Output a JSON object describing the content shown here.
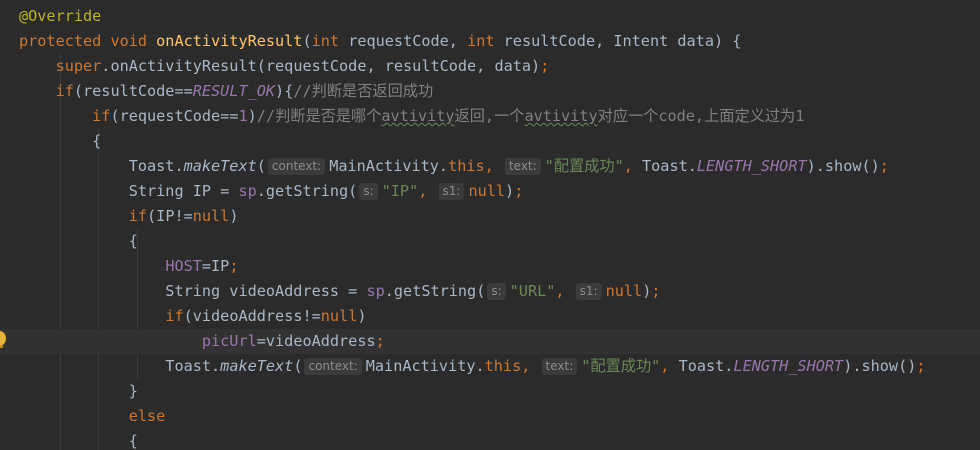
{
  "editor": {
    "language": "java",
    "current_line_index": 13,
    "lines": [
      {
        "tokens": [
          {
            "t": "@Override",
            "c": "ann"
          }
        ]
      },
      {
        "tokens": [
          {
            "t": "protected ",
            "c": "kw"
          },
          {
            "t": "void ",
            "c": "kw"
          },
          {
            "t": "onActivityResult",
            "c": "fn"
          },
          {
            "t": "(",
            "c": "plain"
          },
          {
            "t": "int ",
            "c": "kw"
          },
          {
            "t": "requestCode, ",
            "c": "plain"
          },
          {
            "t": "int ",
            "c": "kw"
          },
          {
            "t": "resultCode, Intent data) {",
            "c": "plain"
          }
        ]
      },
      {
        "tokens": [
          {
            "t": "    ",
            "c": "plain"
          },
          {
            "t": "super",
            "c": "kw"
          },
          {
            "t": ".onActivityResult(requestCode, resultCode, data)",
            "c": "plain"
          },
          {
            "t": ";",
            "c": "kw"
          }
        ]
      },
      {
        "tokens": [
          {
            "t": "    ",
            "c": "plain"
          },
          {
            "t": "if",
            "c": "kw"
          },
          {
            "t": "(resultCode==",
            "c": "plain"
          },
          {
            "t": "RESULT_OK",
            "c": "sfld"
          },
          {
            "t": "){",
            "c": "plain"
          },
          {
            "t": "//判断是否返回成功",
            "c": "com"
          }
        ]
      },
      {
        "tokens": [
          {
            "t": "        ",
            "c": "plain"
          },
          {
            "t": "if",
            "c": "kw"
          },
          {
            "t": "(requestCode==",
            "c": "plain"
          },
          {
            "t": "1",
            "c": "fld"
          },
          {
            "t": ")",
            "c": "plain"
          },
          {
            "t": "//判断是否是哪个",
            "c": "com"
          },
          {
            "t": "avtivity",
            "c": "com typo"
          },
          {
            "t": "返回,一个",
            "c": "com"
          },
          {
            "t": "avtivity",
            "c": "com typo"
          },
          {
            "t": "对应一个code,上面定义过为1",
            "c": "com"
          }
        ]
      },
      {
        "tokens": [
          {
            "t": "        {",
            "c": "plain"
          }
        ]
      },
      {
        "tokens": [
          {
            "t": "            Toast.",
            "c": "plain"
          },
          {
            "t": "makeText",
            "c": "ital"
          },
          {
            "t": "(",
            "c": "plain"
          },
          {
            "t": "context:",
            "c": "hint"
          },
          {
            "t": "MainActivity.",
            "c": "plain"
          },
          {
            "t": "this",
            "c": "kw"
          },
          {
            "t": ", ",
            "c": "kw"
          },
          {
            "t": "text:",
            "c": "hint"
          },
          {
            "t": "\"配置成功\"",
            "c": "str"
          },
          {
            "t": ", ",
            "c": "kw"
          },
          {
            "t": "Toast.",
            "c": "plain"
          },
          {
            "t": "LENGTH_SHORT",
            "c": "sfld"
          },
          {
            "t": ").show()",
            "c": "plain"
          },
          {
            "t": ";",
            "c": "kw"
          }
        ]
      },
      {
        "tokens": [
          {
            "t": "            String IP = ",
            "c": "plain"
          },
          {
            "t": "sp",
            "c": "fld"
          },
          {
            "t": ".getString(",
            "c": "plain"
          },
          {
            "t": "s:",
            "c": "hint"
          },
          {
            "t": "\"IP\"",
            "c": "str"
          },
          {
            "t": ", ",
            "c": "kw"
          },
          {
            "t": "s1:",
            "c": "hint"
          },
          {
            "t": "null",
            "c": "kw"
          },
          {
            "t": ")",
            "c": "plain"
          },
          {
            "t": ";",
            "c": "kw"
          }
        ]
      },
      {
        "tokens": [
          {
            "t": "            ",
            "c": "plain"
          },
          {
            "t": "if",
            "c": "kw"
          },
          {
            "t": "(IP!=",
            "c": "plain"
          },
          {
            "t": "null",
            "c": "kw"
          },
          {
            "t": ")",
            "c": "plain"
          }
        ]
      },
      {
        "tokens": [
          {
            "t": "            {",
            "c": "plain"
          }
        ]
      },
      {
        "tokens": [
          {
            "t": "                ",
            "c": "plain"
          },
          {
            "t": "HOST",
            "c": "fld"
          },
          {
            "t": "=IP",
            "c": "plain"
          },
          {
            "t": ";",
            "c": "kw"
          }
        ]
      },
      {
        "tokens": [
          {
            "t": "                String videoAddress = ",
            "c": "plain"
          },
          {
            "t": "sp",
            "c": "fld"
          },
          {
            "t": ".getString(",
            "c": "plain"
          },
          {
            "t": "s:",
            "c": "hint"
          },
          {
            "t": "\"URL\"",
            "c": "str"
          },
          {
            "t": ", ",
            "c": "kw"
          },
          {
            "t": "s1:",
            "c": "hint"
          },
          {
            "t": "null",
            "c": "kw"
          },
          {
            "t": ")",
            "c": "plain"
          },
          {
            "t": ";",
            "c": "kw"
          }
        ]
      },
      {
        "tokens": [
          {
            "t": "                ",
            "c": "plain"
          },
          {
            "t": "if",
            "c": "kw"
          },
          {
            "t": "(videoAddress!=",
            "c": "plain"
          },
          {
            "t": "null",
            "c": "kw"
          },
          {
            "t": ")",
            "c": "plain"
          }
        ]
      },
      {
        "tokens": [
          {
            "t": "                    ",
            "c": "plain"
          },
          {
            "t": "picUrl",
            "c": "fld"
          },
          {
            "t": "=videoAddress",
            "c": "plain"
          },
          {
            "t": ";",
            "c": "kw"
          }
        ]
      },
      {
        "tokens": [
          {
            "t": "                Toast.",
            "c": "plain"
          },
          {
            "t": "makeText",
            "c": "ital"
          },
          {
            "t": "(",
            "c": "plain"
          },
          {
            "t": "context:",
            "c": "hint"
          },
          {
            "t": "MainActivity.",
            "c": "plain"
          },
          {
            "t": "this",
            "c": "kw"
          },
          {
            "t": ", ",
            "c": "kw"
          },
          {
            "t": "text:",
            "c": "hint"
          },
          {
            "t": "\"配置成功\"",
            "c": "str"
          },
          {
            "t": ", ",
            "c": "kw"
          },
          {
            "t": "Toast.",
            "c": "plain"
          },
          {
            "t": "LENGTH_SHORT",
            "c": "sfld"
          },
          {
            "t": ").show()",
            "c": "plain"
          },
          {
            "t": ";",
            "c": "kw"
          }
        ]
      },
      {
        "tokens": [
          {
            "t": "            }",
            "c": "plain"
          }
        ]
      },
      {
        "tokens": [
          {
            "t": "            ",
            "c": "plain"
          },
          {
            "t": "else",
            "c": "kw"
          }
        ]
      },
      {
        "tokens": [
          {
            "t": "            {",
            "c": "plain"
          }
        ]
      }
    ]
  },
  "gutter": {
    "intention_icon": "lightbulb-icon",
    "intention_line_index": 13
  },
  "colors": {
    "background": "#2b2b2b",
    "current_line": "#323232",
    "keyword": "#cc7832",
    "annotation": "#bbb529",
    "method_declaration": "#ffc66d",
    "string": "#6a8759",
    "field": "#9876aa",
    "comment": "#808080",
    "default_text": "#a9b7c6",
    "inlay_hint_background": "#3b3b3b"
  }
}
